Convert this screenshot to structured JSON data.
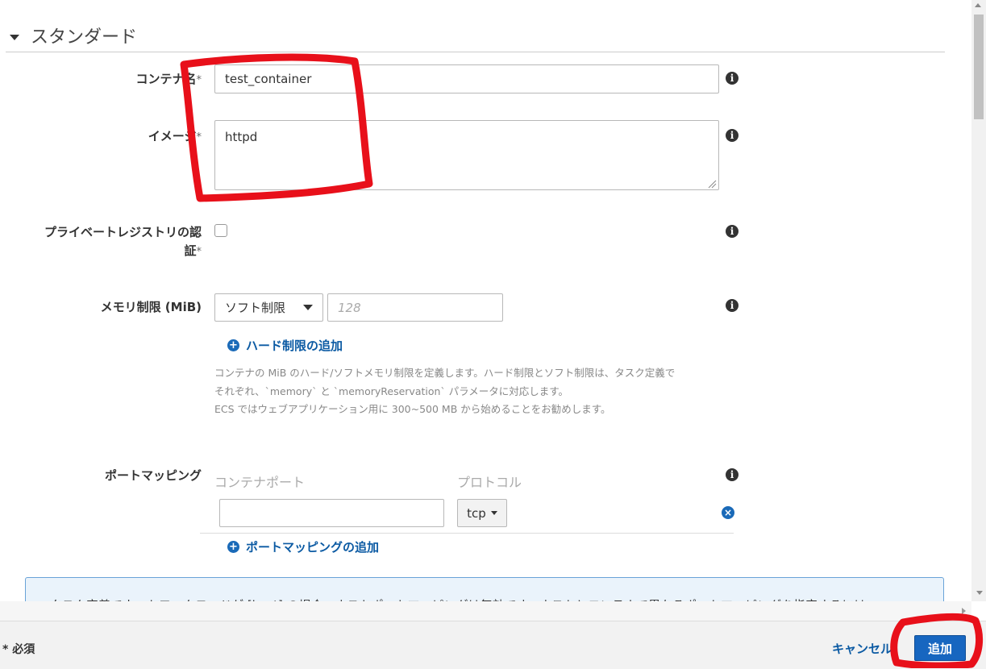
{
  "section": {
    "title": "スタンダード"
  },
  "fields": {
    "container_name": {
      "label": "コンテナ名",
      "required_mark": "*",
      "value": "test_container"
    },
    "image": {
      "label": "イメージ",
      "required_mark": "*",
      "value": "httpd"
    },
    "private_registry": {
      "label_line1": "プライベートレジストリの認",
      "label_line2": "証",
      "required_mark": "*"
    },
    "memory": {
      "label": "メモリ制限 (MiB)",
      "limit_type": "ソフト制限",
      "placeholder": "128",
      "add_hard_limit": "ハード制限の追加",
      "help_lines": [
        "コンテナの MiB のハード/ソフトメモリ制限を定義します。ハード制限とソフト制限は、タスク定義で",
        "それぞれ、`memory` と `memoryReservation` パラメータに対応します。",
        "ECS ではウェブアプリケーション用に 300~500 MB から始めることをお勧めします。"
      ]
    },
    "port_mapping": {
      "label": "ポートマッピング",
      "col_container_port": "コンテナポート",
      "col_protocol": "プロトコル",
      "protocol_value": "tcp",
      "add_link": "ポートマッピングの追加"
    }
  },
  "notice": {
    "text": "タスク定義でネットワークモードが [host] の場合、ホストポートマッピングは無効です。ホストとコンテナで異なるポートマッピングを指定するには"
  },
  "footer": {
    "required_note": "* 必須",
    "cancel": "キャンセル",
    "add": "追加"
  },
  "icons": {
    "info": "info-icon",
    "plus": "plus-circle-icon",
    "remove": "remove-circle-icon"
  },
  "colors": {
    "accent": "#1a6ab8",
    "link": "#0b5aa3",
    "annotation": "#e8101a"
  }
}
